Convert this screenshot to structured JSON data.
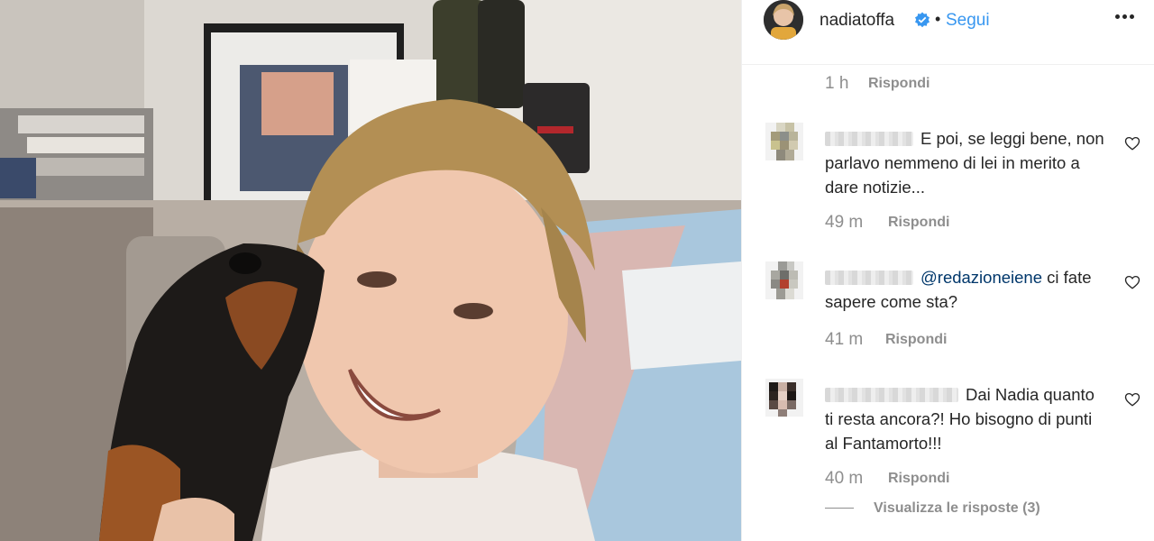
{
  "post": {
    "image_alt": "Woman with short blonde hair smiling on a couch while a small black and tan dog licks her cheek"
  },
  "header": {
    "username": "nadiatoffa",
    "follow_label": "Segui",
    "separator": "•",
    "avatar_icon": "profile-avatar",
    "verified_icon": "verified-badge-icon",
    "more_icon": "more-options-icon",
    "colors": {
      "accent": "#3897f0",
      "text": "#262626",
      "muted": "#8e8e8e"
    }
  },
  "comments": {
    "top_meta": {
      "time": "1 h",
      "reply_label": "Rispondi"
    },
    "items": [
      {
        "username_blurred": true,
        "text": "E poi, se leggi bene, non parlavo nemmeno di lei in merito a dare notizie...",
        "time": "49 m",
        "reply_label": "Rispondi"
      },
      {
        "username_blurred": true,
        "mention": "@redazioneiene",
        "text": " ci fate sapere come sta?",
        "time": "41 m",
        "reply_label": "Rispondi"
      },
      {
        "username_blurred": true,
        "text": "Dai Nadia quanto ti resta ancora?! Ho bisogno di punti al Fantamorto!!!",
        "time": "40 m",
        "reply_label": "Rispondi"
      }
    ],
    "view_replies_label": "Visualizza le risposte (3)"
  }
}
